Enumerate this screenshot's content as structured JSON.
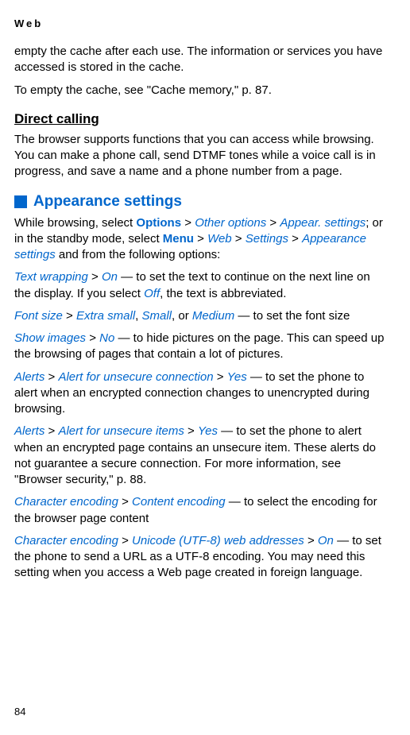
{
  "header": "Web",
  "intro": {
    "p1": "empty the cache after each use. The information or services you have accessed is stored in the cache.",
    "p2_a": "To empty the cache, see \"Cache memory,\" p.",
    "p2_b": "87."
  },
  "direct_calling": {
    "heading": "Direct calling",
    "p1": "The browser supports functions that you can access while browsing. You can make a phone call, send DTMF tones while a voice call is in progress, and save a name and a phone number from a page."
  },
  "appearance": {
    "heading": "Appearance settings",
    "intro_a": "While browsing, select ",
    "options": "Options",
    "other_options": "Other options",
    "appear_settings": "Appear. settings",
    "intro_b": "; or in the standby mode, select ",
    "menu": "Menu",
    "web": "Web",
    "settings": "Settings",
    "appearance_settings": "Appearance settings",
    "intro_c": " and from the following options:",
    "text_wrapping": "Text wrapping",
    "on": "On",
    "text_wrapping_desc": " — to set the text to continue on the next line on the display. If you select ",
    "off": "Off",
    "text_wrapping_end": ", the text is abbreviated.",
    "font_size": "Font size",
    "extra_small": "Extra small",
    "small": "Small",
    "or": ", or ",
    "medium": "Medium",
    "font_size_desc": " — to set the font size",
    "show_images": "Show images",
    "no": "No",
    "show_images_desc": " — to hide pictures on the page. This can speed up the browsing of pages that contain a lot of pictures.",
    "alerts": "Alerts",
    "alert_unsecure_conn": "Alert for unsecure connection",
    "yes": "Yes",
    "alert_conn_desc": " — to set the phone to alert when an encrypted connection changes to unencrypted during browsing.",
    "alert_unsecure_items": "Alert for unsecure items",
    "alert_items_desc": " — to set the phone to alert when an encrypted page contains an unsecure item. These alerts do not guarantee a secure connection. For more information, see \"Browser security,\" p.",
    "page_ref": " 88.",
    "char_encoding": "Character encoding",
    "content_encoding": "Content encoding",
    "content_encoding_desc": " — to select the encoding for the browser page content",
    "unicode_addresses": "Unicode (UTF-8) web addresses",
    "unicode_desc": " — to set the phone to send a URL as a UTF-8 encoding. You may need this setting when you access a Web page created in foreign language."
  },
  "page_number": "84",
  "gt": " > ",
  "comma": ", "
}
